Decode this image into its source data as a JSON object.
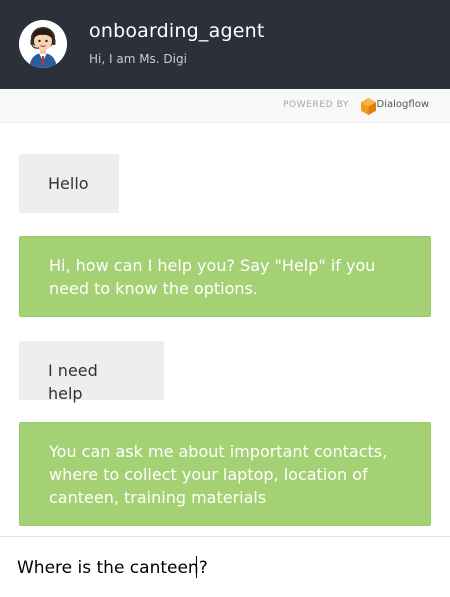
{
  "header": {
    "agent_name": "onboarding_agent",
    "agent_subtitle": "Hi, I am Ms. Digi",
    "avatar_icon": "agent-avatar-icon"
  },
  "powered": {
    "label": "POWERED BY",
    "brand": "Dialogflow",
    "logo_color": "#f29a20"
  },
  "messages": [
    {
      "from": "user",
      "text": "Hello"
    },
    {
      "from": "bot",
      "text": "Hi, how can I help you? Say \"Help\" if you need to know the options."
    },
    {
      "from": "user",
      "text": "I need help"
    },
    {
      "from": "bot",
      "text": "You can ask me about important contacts, where to collect your laptop, location of canteen, training materials"
    }
  ],
  "input": {
    "value": "Where is the canteen?"
  },
  "colors": {
    "header_bg": "#2b303b",
    "bot_bubble": "#a5d175",
    "user_bubble": "#eeeeee"
  }
}
